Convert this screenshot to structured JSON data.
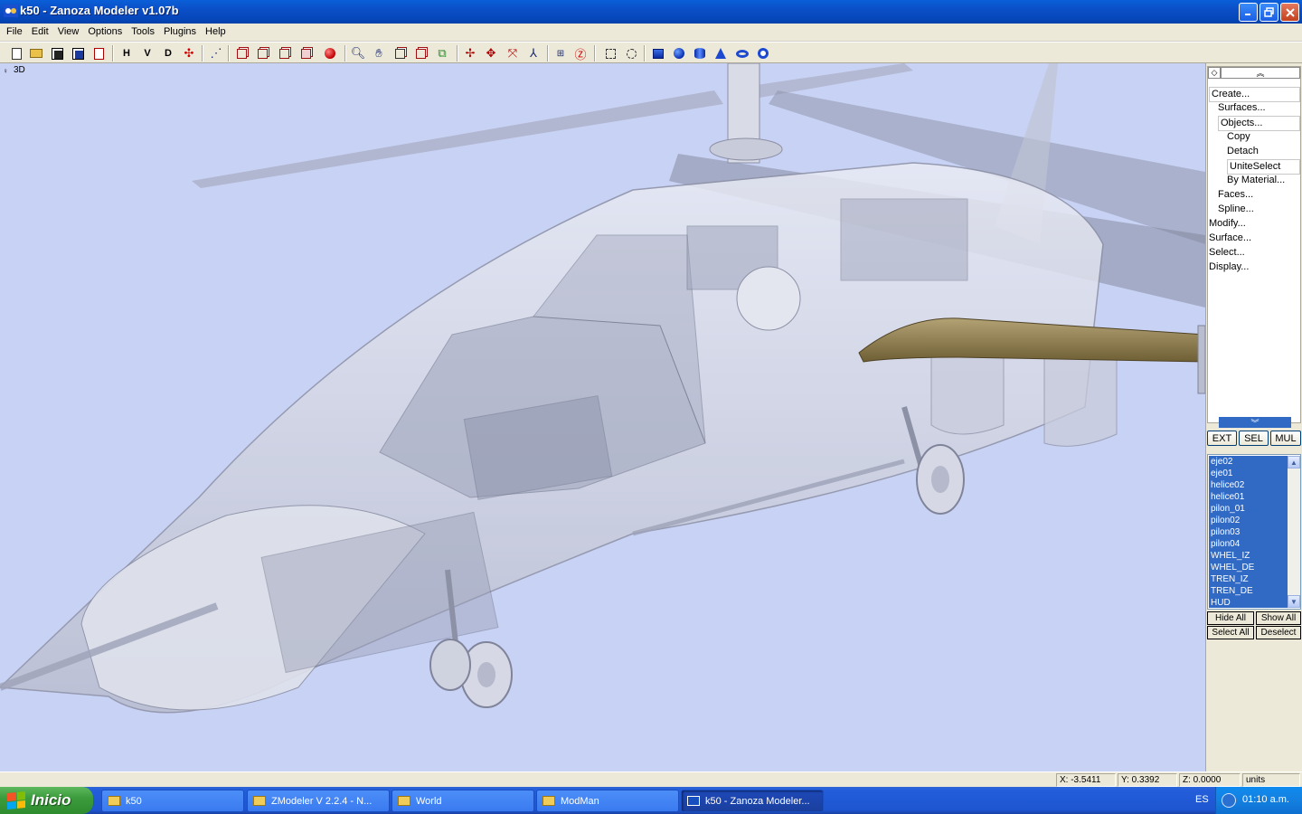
{
  "window": {
    "title": "k50 - Zanoza Modeler v1.07b"
  },
  "menu": [
    "File",
    "Edit",
    "View",
    "Options",
    "Tools",
    "Plugins",
    "Help"
  ],
  "toolbar": {
    "h_label": "H",
    "v_label": "V",
    "d_label": "D"
  },
  "viewport": {
    "label": "3D"
  },
  "command_tree": [
    {
      "label": "Create...",
      "indent": 0,
      "boxed": true
    },
    {
      "label": "Surfaces...",
      "indent": 1,
      "boxed": false
    },
    {
      "label": "Objects...",
      "indent": 1,
      "boxed": true
    },
    {
      "label": "Copy",
      "indent": 2,
      "boxed": false
    },
    {
      "label": "Detach",
      "indent": 2,
      "boxed": false
    },
    {
      "label": "UniteSelect",
      "indent": 2,
      "boxed": true
    },
    {
      "label": "By Material...",
      "indent": 2,
      "boxed": false
    },
    {
      "label": "Faces...",
      "indent": 1,
      "boxed": false
    },
    {
      "label": "Spline...",
      "indent": 1,
      "boxed": false
    },
    {
      "label": "Modify...",
      "indent": 0,
      "boxed": false
    },
    {
      "label": "Surface...",
      "indent": 0,
      "boxed": false
    },
    {
      "label": "Select...",
      "indent": 0,
      "boxed": false
    },
    {
      "label": "Display...",
      "indent": 0,
      "boxed": false
    }
  ],
  "mode_buttons": {
    "ext": "EXT",
    "sel": "SEL",
    "mul": "MUL"
  },
  "objects": [
    "eje02",
    "eje01",
    "helice02",
    "helice01",
    "pilon_01",
    "pilon02",
    "pilon03",
    "pilon04",
    "WHEL_IZ",
    "WHEL_DE",
    "TREN_IZ",
    "TREN_DE",
    "HUD"
  ],
  "list_buttons": {
    "hide_all": "Hide All",
    "show_all": "Show All",
    "select_all": "Select All",
    "deselect": "Deselect"
  },
  "status": {
    "x": "X: -3.5411",
    "y": "Y: 0.3392",
    "z": "Z: 0.0000",
    "units": "units"
  },
  "taskbar": {
    "start": "Inicio",
    "tasks": [
      "k50",
      "ZModeler V 2.2.4 - N...",
      "World",
      "ModMan",
      "k50 - Zanoza Modeler..."
    ],
    "lang": "ES",
    "clock": "01:10 a.m."
  },
  "colors": {
    "viewport_bg": "#c8d2f4",
    "selection": "#316ac5",
    "wing": "#8b7a4a"
  }
}
